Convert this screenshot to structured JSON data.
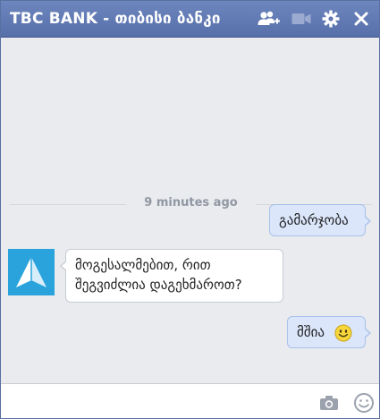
{
  "window": {
    "title": "TBC BANK - თიბისი ბანკი"
  },
  "toolbar": {
    "icons": [
      "add-friends-icon",
      "video-call-icon",
      "settings-gear-icon",
      "close-icon"
    ]
  },
  "conversation": {
    "timestamp": "9 minutes ago",
    "messages": [
      {
        "direction": "outgoing",
        "text": "გამარჯობა"
      },
      {
        "direction": "incoming",
        "line1": "მოგესალმებით, რით",
        "line2": "შეგვიძლია დაგეხმაროთ?"
      },
      {
        "direction": "outgoing",
        "text": "მშია",
        "emoji": "smiley-icon"
      }
    ]
  },
  "composer": {
    "value": "",
    "icons": [
      "camera-icon",
      "emoji-icon"
    ]
  },
  "colors": {
    "titlebar": "#6e86be",
    "background": "#e9ebee",
    "outgoing_bubble": "#dbe6fb",
    "incoming_bubble": "#ffffff",
    "brand_logo": "#2aa3dc"
  }
}
